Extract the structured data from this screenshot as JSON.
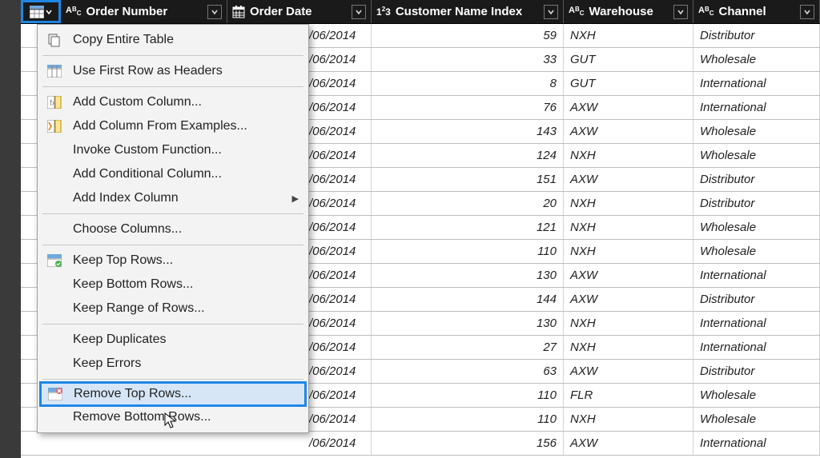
{
  "columns": {
    "order_number": "Order Number",
    "order_date": "Order Date",
    "customer_name_index": "Customer Name Index",
    "warehouse": "Warehouse",
    "channel": "Channel"
  },
  "rows": [
    {
      "date": "/06/2014",
      "idx": 59,
      "wh": "NXH",
      "ch": "Distributor"
    },
    {
      "date": "/06/2014",
      "idx": 33,
      "wh": "GUT",
      "ch": "Wholesale"
    },
    {
      "date": "/06/2014",
      "idx": 8,
      "wh": "GUT",
      "ch": "International"
    },
    {
      "date": "/06/2014",
      "idx": 76,
      "wh": "AXW",
      "ch": "International"
    },
    {
      "date": "/06/2014",
      "idx": 143,
      "wh": "AXW",
      "ch": "Wholesale"
    },
    {
      "date": "/06/2014",
      "idx": 124,
      "wh": "NXH",
      "ch": "Wholesale"
    },
    {
      "date": "/06/2014",
      "idx": 151,
      "wh": "AXW",
      "ch": "Distributor"
    },
    {
      "date": "/06/2014",
      "idx": 20,
      "wh": "NXH",
      "ch": "Distributor"
    },
    {
      "date": "/06/2014",
      "idx": 121,
      "wh": "NXH",
      "ch": "Wholesale"
    },
    {
      "date": "/06/2014",
      "idx": 110,
      "wh": "NXH",
      "ch": "Wholesale"
    },
    {
      "date": "/06/2014",
      "idx": 130,
      "wh": "AXW",
      "ch": "International"
    },
    {
      "date": "/06/2014",
      "idx": 144,
      "wh": "AXW",
      "ch": "Distributor"
    },
    {
      "date": "/06/2014",
      "idx": 130,
      "wh": "NXH",
      "ch": "International"
    },
    {
      "date": "/06/2014",
      "idx": 27,
      "wh": "NXH",
      "ch": "International"
    },
    {
      "date": "/06/2014",
      "idx": 63,
      "wh": "AXW",
      "ch": "Distributor"
    },
    {
      "date": "/06/2014",
      "idx": 110,
      "wh": "FLR",
      "ch": "Wholesale"
    },
    {
      "date": "/06/2014",
      "idx": 110,
      "wh": "NXH",
      "ch": "Wholesale"
    },
    {
      "date": "/06/2014",
      "idx": 156,
      "wh": "AXW",
      "ch": "International"
    }
  ],
  "menu": {
    "copy_entire_table": "Copy Entire Table",
    "use_first_row_as_headers": "Use First Row as Headers",
    "add_custom_column": "Add Custom Column...",
    "add_column_from_examples": "Add Column From Examples...",
    "invoke_custom_function": "Invoke Custom Function...",
    "add_conditional_column": "Add Conditional Column...",
    "add_index_column": "Add Index Column",
    "choose_columns": "Choose Columns...",
    "keep_top_rows": "Keep Top Rows...",
    "keep_bottom_rows": "Keep Bottom Rows...",
    "keep_range_of_rows": "Keep Range of Rows...",
    "keep_duplicates": "Keep Duplicates",
    "keep_errors": "Keep Errors",
    "remove_top_rows": "Remove Top Rows...",
    "remove_bottom_rows": "Remove Bottom Rows..."
  }
}
